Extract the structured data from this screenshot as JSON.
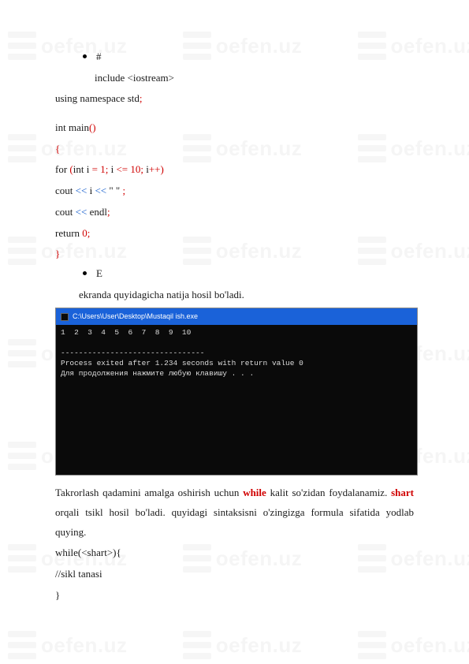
{
  "watermark": "oefen.uz",
  "code": {
    "bullet1": "#",
    "l1": "include <iostream>",
    "l2_a": "using namespace std",
    "l2_b": ";",
    "l3_a": "int main",
    "l3_b": "()",
    "l4": "{",
    "l5_a": "for ",
    "l5_b": "(",
    "l5_c": "int i ",
    "l5_d": "= 1; ",
    "l5_e": "i ",
    "l5_f": "<= 10; ",
    "l5_g": "i",
    "l5_h": "++)",
    "l6_a": "cout  ",
    "l6_b": "<<",
    "l6_c": "  i  ",
    "l6_d": "<<",
    "l6_e": "  \"   \" ",
    "l6_f": ";",
    "l7_a": "cout  ",
    "l7_b": "<<",
    "l7_c": "  endl",
    "l7_d": ";",
    "l8_a": "return ",
    "l8_b": "0",
    "l8_c": ";",
    "l9": "}",
    "bullet2": "E",
    "l10": "ekranda quyidagicha natija hosil bo'ladi."
  },
  "terminal": {
    "title": "C:\\Users\\User\\Desktop\\Mustaqil ish.exe",
    "out1": "1  2  3  4  5  6  7  8  9  10",
    "out_blank": "",
    "out_dash": "--------------------------------",
    "out2": "Process exited after 1.234 seconds with return value 0",
    "out3": "Для продолжения нажмите любую клавишу . . ."
  },
  "prose": {
    "p1_a": "Takrorlash qadamini amalga oshirish uchun ",
    "p1_b": "while",
    "p1_c": " kalit so'zidan foydalanamiz. ",
    "p1_d": "shart",
    "p1_e": " orqali tsikl hosil bo'ladi. quyidagi sintaksisni o'zingizga formula sifatida yodlab quying.",
    "p2": "while(<shart>){",
    "p3": "//sikl tanasi",
    "p4": "}"
  }
}
